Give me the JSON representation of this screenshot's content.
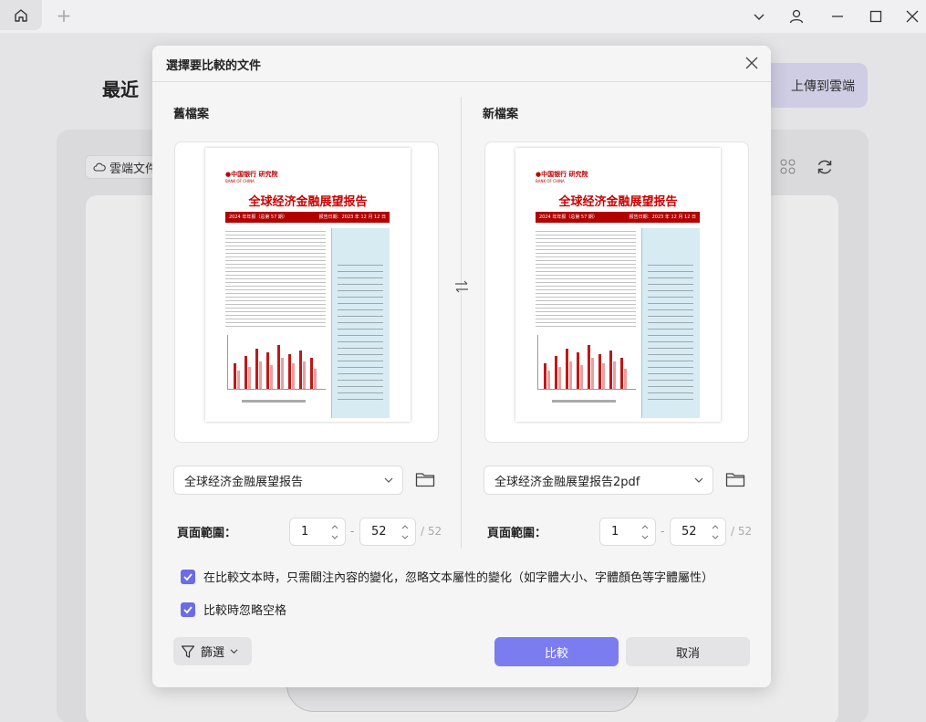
{
  "background": {
    "section_title": "最近",
    "upload_button": "上傳到雲端",
    "cloud_files": "雲端文件"
  },
  "dialog": {
    "title": "選擇要比較的文件",
    "old": {
      "heading": "舊檔案",
      "file": "全球经济金融展望报告",
      "range_label": "頁面範圍：",
      "start": "1",
      "end": "52",
      "total": "/ 52"
    },
    "new": {
      "heading": "新檔案",
      "file": "全球经济金融展望报告2pdf",
      "range_label": "頁面範圍：",
      "start": "1",
      "end": "52",
      "total": "/ 52"
    },
    "preview": {
      "doc_title": "全球经济金融展望报告",
      "band_left": "2024 年年报（总第 57 期）",
      "band_right": "报告日期：2023 年 12 月 12 日"
    },
    "options": {
      "ignore_attributes": "在比較文本時，只需關注內容的變化，忽略文本屬性的變化（如字體大小、字體顏色等字體屬性）",
      "ignore_spaces": "比較時忽略空格"
    },
    "buttons": {
      "filter": "篩選",
      "compare": "比較",
      "cancel": "取消"
    }
  },
  "colors": {
    "accent": "#7b7cf0",
    "checkbox": "#6b6ce6",
    "doc_red": "#c00000"
  }
}
